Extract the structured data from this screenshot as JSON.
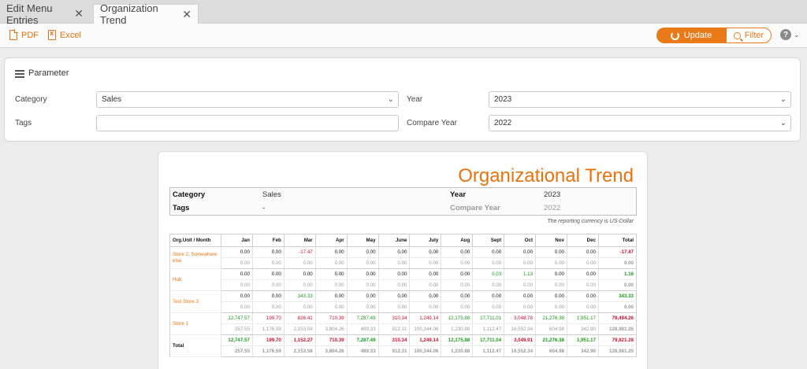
{
  "tabs": [
    {
      "label": "Edit Menu Entries",
      "close": "✕"
    },
    {
      "label": "Organization Trend",
      "close": "✕"
    }
  ],
  "toolbar": {
    "pdf_label": "PDF",
    "excel_label": "Excel",
    "update_label": "Update",
    "filter_label": "Filter",
    "help_label": "?",
    "help_chevron": "⌄"
  },
  "parameter": {
    "title": "Parameter",
    "category_label": "Category",
    "category_value": "Sales",
    "tags_label": "Tags",
    "tags_value": "",
    "year_label": "Year",
    "year_value": "2023",
    "compare_year_label": "Compare Year",
    "compare_year_value": "2022"
  },
  "report": {
    "title": "Organizational Trend",
    "header": {
      "category_label": "Category",
      "category_value": "Sales",
      "tags_label": "Tags",
      "tags_value": "-",
      "year_label": "Year",
      "year_value": "2023",
      "compare_year_label": "Compare Year",
      "compare_year_value": "2022"
    },
    "currency_note": "The reporting currency is US-Dollar",
    "columns": [
      "Org.Unit / Month",
      "Jan",
      "Feb",
      "Mar",
      "Apr",
      "May",
      "June",
      "July",
      "Aug",
      "Sept",
      "Oct",
      "Nov",
      "Dec",
      "Total"
    ],
    "rows": [
      {
        "unit": "Store 2, Somewhere else",
        "current": [
          "0.00",
          "0.00",
          "-17.47",
          "0.00",
          "0.00",
          "0.00",
          "0.00",
          "0.00",
          "0.00",
          "0.00",
          "0.00",
          "0.00",
          "-17.47"
        ],
        "current_status": [
          "",
          "",
          "neg",
          "",
          "",
          "",
          "",
          "",
          "",
          "",
          "",
          "",
          "neg"
        ],
        "previous": [
          "0.00",
          "0.00",
          "0.00",
          "0.00",
          "0.00",
          "0.00",
          "0.00",
          "0.00",
          "0.00",
          "0.00",
          "0.00",
          "0.00",
          "0.00"
        ]
      },
      {
        "unit": "Hub",
        "current": [
          "0.00",
          "0.00",
          "0.00",
          "0.00",
          "0.00",
          "0.00",
          "0.00",
          "0.00",
          "0.03",
          "1.13",
          "0.00",
          "0.00",
          "1.16"
        ],
        "current_status": [
          "",
          "",
          "",
          "",
          "",
          "",
          "",
          "",
          "pos",
          "pos",
          "",
          "",
          "pos"
        ],
        "previous": [
          "0.00",
          "0.00",
          "0.00",
          "0.00",
          "0.00",
          "0.00",
          "0.00",
          "0.00",
          "0.00",
          "0.00",
          "0.00",
          "0.00",
          "0.00"
        ]
      },
      {
        "unit": "Test Store 3",
        "current": [
          "0.00",
          "0.00",
          "343.33",
          "0.00",
          "0.00",
          "0.00",
          "0.00",
          "0.00",
          "0.00",
          "0.00",
          "0.00",
          "0.00",
          "343.33"
        ],
        "current_status": [
          "",
          "",
          "pos",
          "",
          "",
          "",
          "",
          "",
          "",
          "",
          "",
          "",
          "pos"
        ],
        "previous": [
          "0.00",
          "0.00",
          "0.00",
          "0.00",
          "0.00",
          "0.00",
          "0.00",
          "0.00",
          "0.00",
          "0.00",
          "0.00",
          "0.00",
          "0.00"
        ]
      },
      {
        "unit": "Store 1",
        "current": [
          "12,747.57",
          "199.70",
          "826.41",
          "710.39",
          "7,287.49",
          "310.34",
          "1,249.14",
          "12,175.88",
          "17,711.01",
          "3,048.78",
          "21,276.38",
          "1,951.17",
          "79,494.26"
        ],
        "current_status": [
          "pos",
          "neg",
          "neg",
          "neg",
          "pos",
          "neg",
          "neg",
          "pos",
          "pos",
          "neg",
          "pos",
          "pos",
          "neg"
        ],
        "previous": [
          "257.55",
          "1,176.59",
          "2,153.58",
          "3,804.26",
          "489.33",
          "912.31",
          "100,344.06",
          "1,230.88",
          "1,112.47",
          "16,552.34",
          "604.98",
          "342.90",
          "128,981.25"
        ]
      },
      {
        "unit": "Total",
        "is_total": true,
        "current": [
          "12,747.57",
          "199.70",
          "1,152.27",
          "710.39",
          "7,287.49",
          "310.34",
          "1,249.14",
          "12,175.88",
          "17,711.04",
          "3,049.91",
          "21,276.38",
          "1,951.17",
          "79,821.28"
        ],
        "current_status": [
          "pos",
          "neg",
          "neg",
          "neg",
          "pos",
          "neg",
          "neg",
          "pos",
          "pos",
          "neg",
          "pos",
          "pos",
          "neg"
        ],
        "previous": [
          "257.55",
          "1,176.59",
          "2,153.58",
          "3,804.26",
          "489.33",
          "912.31",
          "100,344.06",
          "1,230.88",
          "1,112.47",
          "16,552.34",
          "604.98",
          "342.90",
          "128,981.25"
        ]
      }
    ]
  },
  "colors": {
    "accent": "#e8730c",
    "positive": "#1a9a1a",
    "negative": "#c8102e"
  }
}
